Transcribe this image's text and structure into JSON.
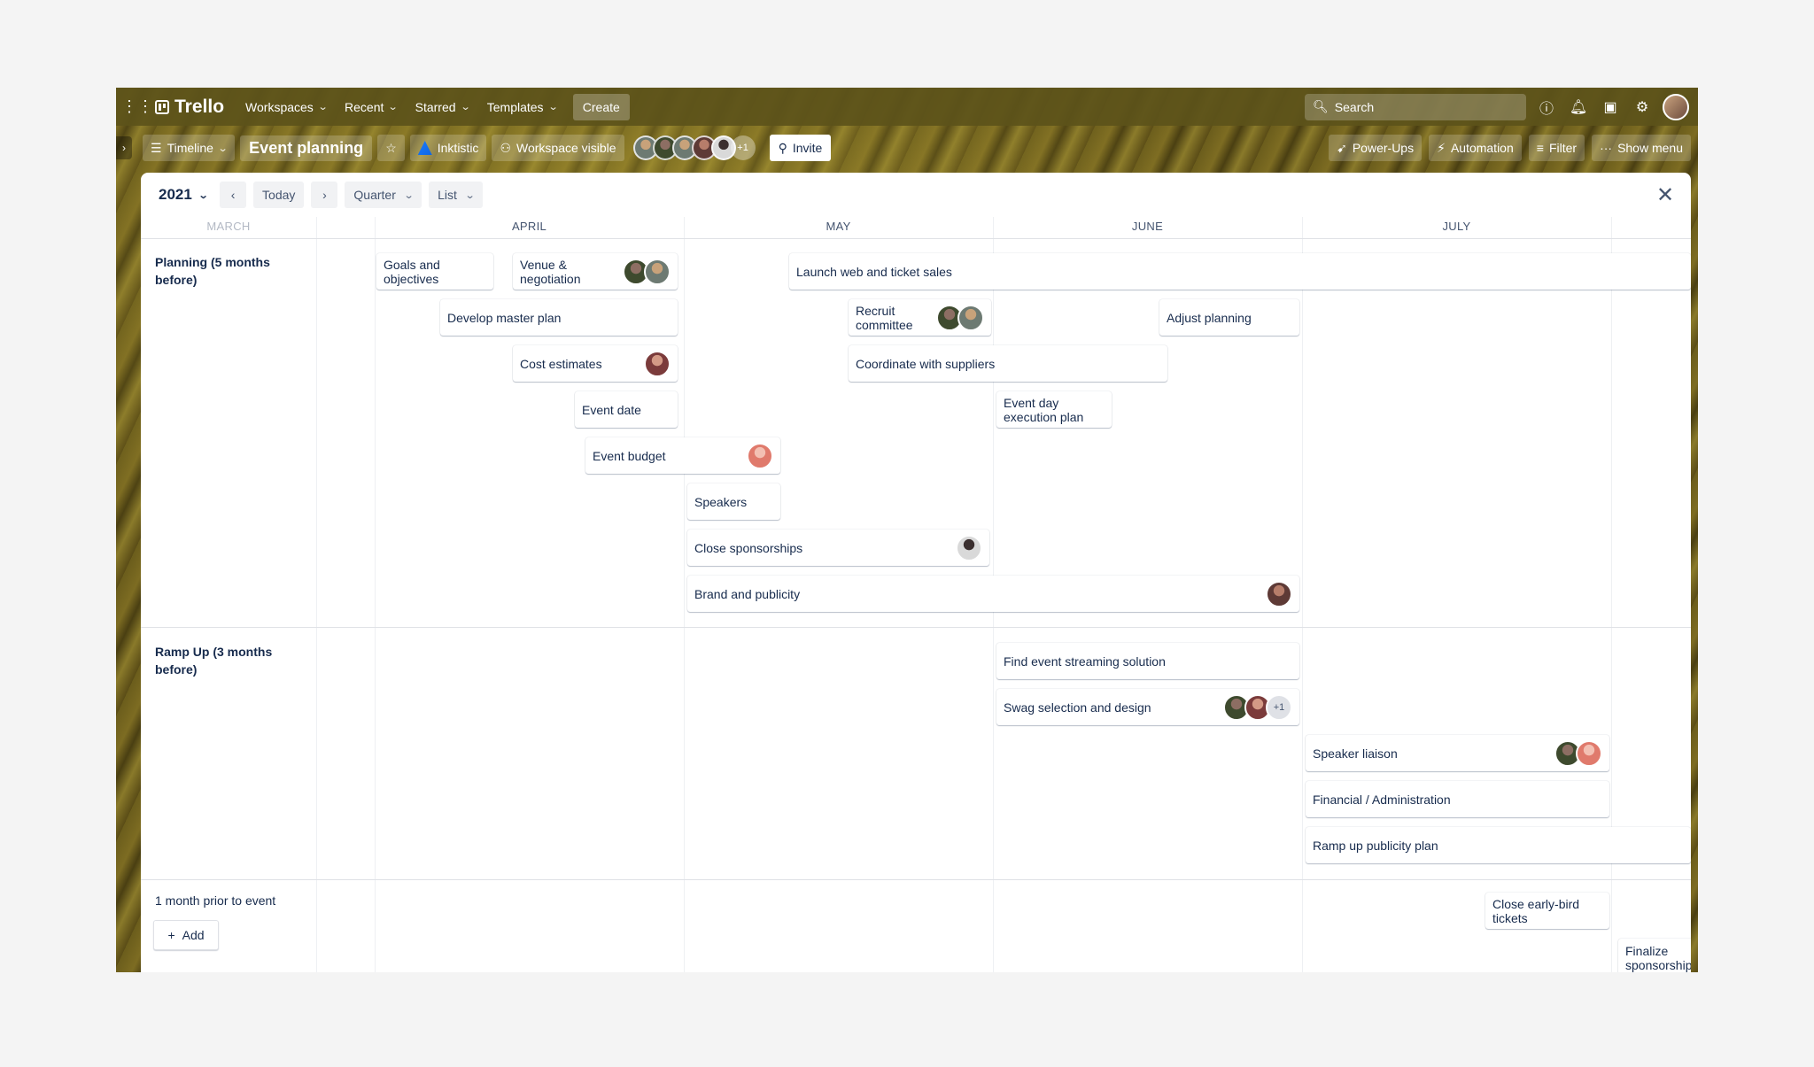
{
  "topnav": {
    "brand": "Trello",
    "menus": [
      "Workspaces",
      "Recent",
      "Starred",
      "Templates"
    ],
    "create_label": "Create",
    "search_placeholder": "Search"
  },
  "boardbar": {
    "view_label": "Timeline",
    "board_title": "Event planning",
    "workspace_name": "Inktistic",
    "visibility_label": "Workspace visible",
    "members_more": "+1",
    "invite_label": "Invite",
    "powerups_label": "Power-Ups",
    "automation_label": "Automation",
    "filter_label": "Filter",
    "show_menu_label": "Show menu"
  },
  "toolbar": {
    "year": "2021",
    "today_label": "Today",
    "range_label": "Quarter",
    "group_label": "List"
  },
  "months": [
    "MARCH",
    "APRIL",
    "MAY",
    "JUNE",
    "JULY"
  ],
  "groups": [
    "Planning (5 months before)",
    "Ramp Up (3 months before)",
    "1 month prior to event"
  ],
  "add_label": "Add",
  "cards": [
    "Goals and objectives",
    "Venue & negotiation",
    "Launch web and ticket sales",
    "Develop master plan",
    "Recruit committee",
    "Adjust planning",
    "Cost estimates",
    "Coordinate with suppliers",
    "Event date",
    "Event day execution plan",
    "Event budget",
    "Speakers",
    "Close sponsorships",
    "Brand and publicity",
    "Find event streaming solution",
    "Swag selection and design",
    "Speaker liaison",
    "Financial / Administration",
    "Ramp up publicity plan",
    "Close early-bird tickets",
    "Finalize sponsorship"
  ],
  "more_members_chip": "+1"
}
